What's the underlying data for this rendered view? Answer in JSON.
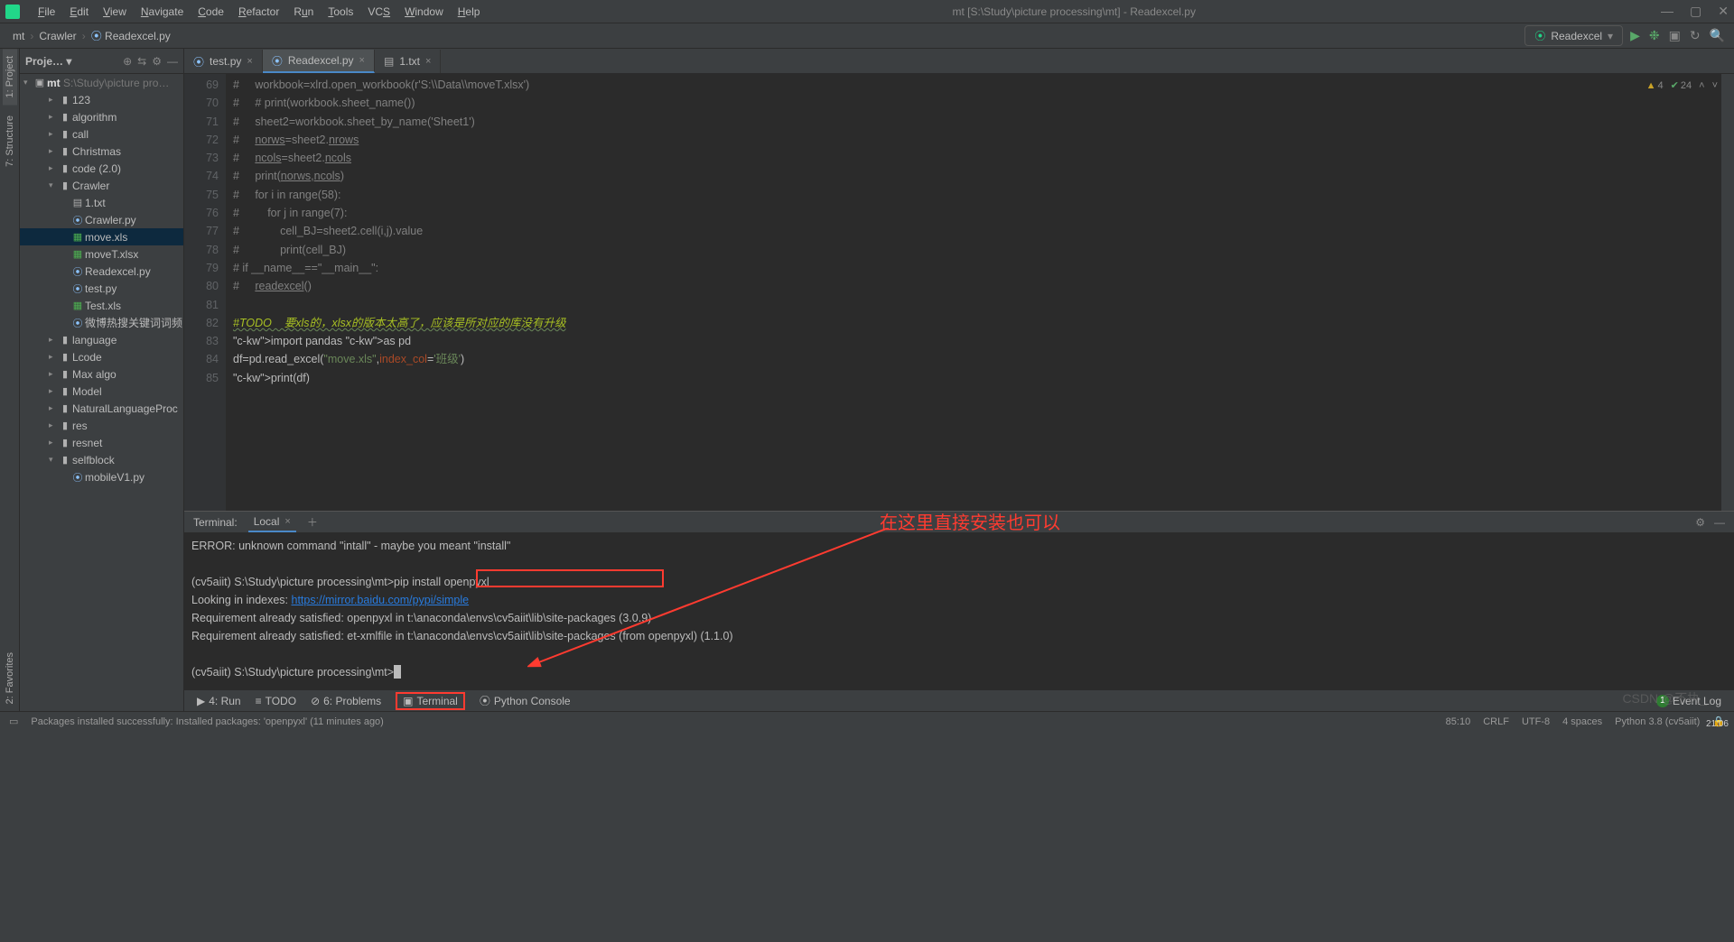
{
  "window": {
    "title": "mt [S:\\Study\\picture processing\\mt] - Readexcel.py"
  },
  "menu": [
    "File",
    "Edit",
    "View",
    "Navigate",
    "Code",
    "Refactor",
    "Run",
    "Tools",
    "VCS",
    "Window",
    "Help"
  ],
  "breadcrumbs": [
    "mt",
    "Crawler",
    "Readexcel.py"
  ],
  "run_config": {
    "label": "Readexcel"
  },
  "sidebar": {
    "title": "Proje…",
    "root": {
      "name": "mt",
      "path": "S:\\Study\\picture pro…"
    },
    "items": [
      {
        "name": "123",
        "kind": "folder",
        "depth": 2,
        "collapsed": true
      },
      {
        "name": "algorithm",
        "kind": "folder",
        "depth": 2,
        "collapsed": true
      },
      {
        "name": "call",
        "kind": "folder",
        "depth": 2,
        "collapsed": true
      },
      {
        "name": "Christmas",
        "kind": "folder",
        "depth": 2,
        "collapsed": true
      },
      {
        "name": "code   (2.0)",
        "kind": "folder",
        "depth": 2,
        "collapsed": true
      },
      {
        "name": "Crawler",
        "kind": "folder",
        "depth": 2,
        "collapsed": false
      },
      {
        "name": "1.txt",
        "kind": "txt",
        "depth": 3
      },
      {
        "name": "Crawler.py",
        "kind": "py",
        "depth": 3
      },
      {
        "name": "move.xls",
        "kind": "xls",
        "depth": 3,
        "sel": true
      },
      {
        "name": "moveT.xlsx",
        "kind": "xls",
        "depth": 3
      },
      {
        "name": "Readexcel.py",
        "kind": "py",
        "depth": 3
      },
      {
        "name": "test.py",
        "kind": "py",
        "depth": 3
      },
      {
        "name": "Test.xls",
        "kind": "xls",
        "depth": 3
      },
      {
        "name": "微博热搜关键词词频",
        "kind": "py",
        "depth": 3
      },
      {
        "name": "language",
        "kind": "folder",
        "depth": 2,
        "collapsed": true
      },
      {
        "name": "Lcode",
        "kind": "folder",
        "depth": 2,
        "collapsed": true
      },
      {
        "name": "Max algo",
        "kind": "folder",
        "depth": 2,
        "collapsed": true
      },
      {
        "name": "Model",
        "kind": "folder",
        "depth": 2,
        "collapsed": true
      },
      {
        "name": "NaturalLanguageProc",
        "kind": "folder",
        "depth": 2,
        "collapsed": true
      },
      {
        "name": "res",
        "kind": "folder",
        "depth": 2,
        "collapsed": true
      },
      {
        "name": "resnet",
        "kind": "folder",
        "depth": 2,
        "collapsed": true
      },
      {
        "name": "selfblock",
        "kind": "folder",
        "depth": 2,
        "collapsed": false
      },
      {
        "name": "mobileV1.py",
        "kind": "py",
        "depth": 3
      }
    ]
  },
  "editor": {
    "tabs": [
      {
        "label": "test.py",
        "icon": "py"
      },
      {
        "label": "Readexcel.py",
        "icon": "py",
        "active": true
      },
      {
        "label": "1.txt",
        "icon": "txt"
      }
    ],
    "first_line": 69,
    "lines": [
      "#     workbook=xlrd.open_workbook(r'S:\\\\Data\\\\moveT.xlsx')",
      "#     # print(workbook.sheet_name())",
      "#     sheet2=workbook.sheet_by_name('Sheet1')",
      "#     norws=sheet2.nrows",
      "#     ncols=sheet2.ncols",
      "#     print(norws,ncols)",
      "#     for i in range(58):",
      "#         for j in range(7):",
      "#             cell_BJ=sheet2.cell(i,j).value",
      "#             print(cell_BJ)",
      "# if __name__==\"__main__\":",
      "#     readexcel()",
      "",
      "#TODO    要xls的，xlsx的版本太高了，应该是所对应的库没有升级",
      "import pandas as pd",
      "df=pd.read_excel(\"move.xls\",index_col='班级')",
      "print(df)"
    ],
    "inspect": {
      "warn": "4",
      "ok": "24"
    }
  },
  "terminal": {
    "title": "Terminal:",
    "tab": "Local",
    "annotation": "在这里直接安装也可以",
    "lines": [
      "ERROR: unknown command \"intall\" - maybe you meant \"install\"",
      "",
      "(cv5aiit) S:\\Study\\picture processing\\mt>pip install openpyxl",
      "Looking in indexes: https://mirror.baidu.com/pypi/simple",
      "Requirement already satisfied: openpyxl in t:\\anaconda\\envs\\cv5aiit\\lib\\site-packages (3.0.9)",
      "Requirement already satisfied: et-xmlfile in t:\\anaconda\\envs\\cv5aiit\\lib\\site-packages (from openpyxl) (1.1.0)",
      "",
      "(cv5aiit) S:\\Study\\picture processing\\mt>"
    ],
    "link": "https://mirror.baidu.com/pypi/simple"
  },
  "bottom_tools": {
    "run": "4: Run",
    "todo": "TODO",
    "problems": "6: Problems",
    "terminal": "Terminal",
    "pyconsole": "Python Console",
    "eventlog": "Event Log"
  },
  "status": {
    "msg": "Packages installed successfully: Installed packages: 'openpyxl' (11 minutes ago)",
    "pos": "85:10",
    "eol": "CRLF",
    "enc": "UTF-8",
    "indent": "4 spaces",
    "python": "Python 3.8 (cv5aiit)",
    "clock": "21:06"
  },
  "watermark": "CSDN @不执_",
  "left_tabs": [
    "1: Project",
    "7: Structure",
    "2: Favorites"
  ]
}
